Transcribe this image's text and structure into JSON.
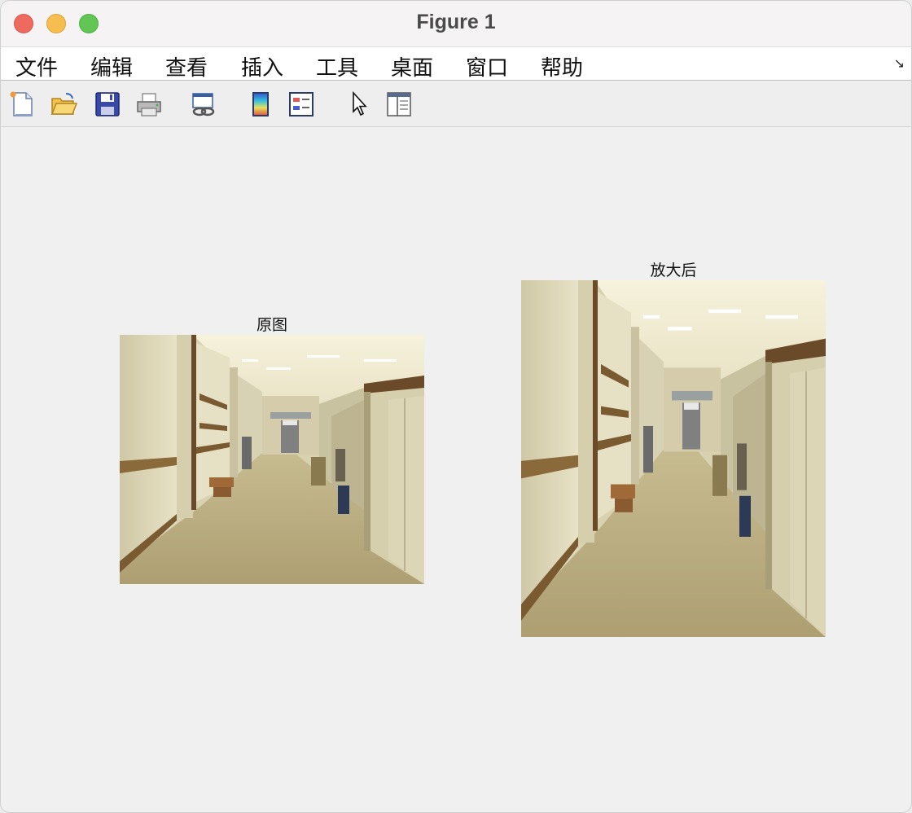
{
  "window": {
    "title": "Figure 1"
  },
  "menu": {
    "items": [
      "文件",
      "编辑",
      "查看",
      "插入",
      "工具",
      "桌面",
      "窗口",
      "帮助"
    ]
  },
  "toolbar": {
    "icons": [
      "new-figure-icon",
      "open-file-icon",
      "save-icon",
      "print-icon",
      "link-plot-icon",
      "colorbar-icon",
      "legend-icon",
      "pointer-icon",
      "property-inspector-icon"
    ]
  },
  "axes": [
    {
      "title": "原图",
      "content": "photo of an office hallway"
    },
    {
      "title": "放大后",
      "content": "enlarged photo of an office hallway"
    }
  ]
}
